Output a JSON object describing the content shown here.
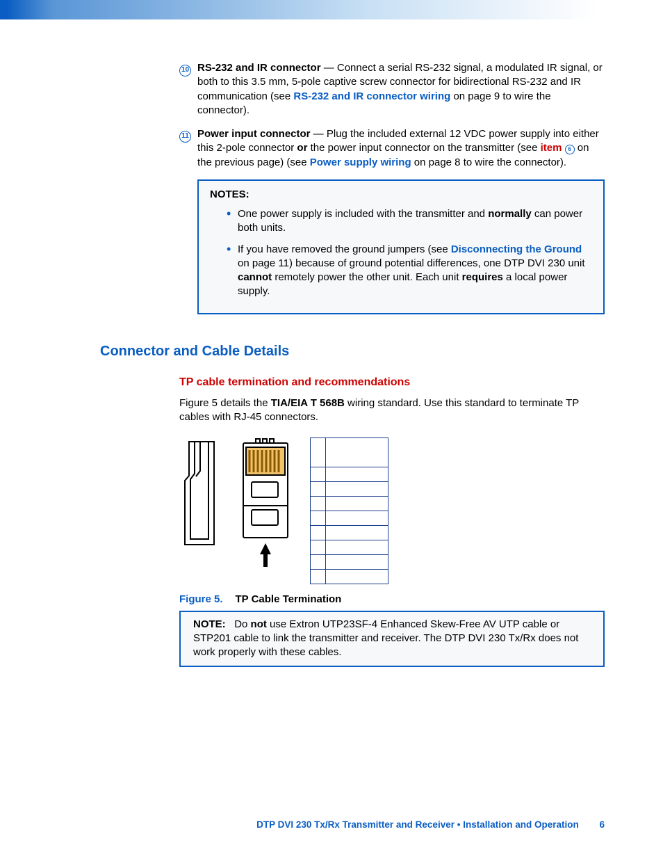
{
  "items": {
    "ten": {
      "num": "10",
      "title": "RS-232 and IR connector",
      "t1": " — Connect a serial RS-232 signal, a modulated IR signal, or both to this 3.5 mm, 5-pole captive screw connector for bidirectional RS-232 and IR communication (see ",
      "link1": "RS-232 and IR connector wiring",
      "t2": " on page 9 to wire the connector)."
    },
    "eleven": {
      "num": "11",
      "title": "Power input connector",
      "t1": " — Plug the included external 12 VDC power supply into either this 2-pole connector ",
      "or": "or",
      "t2": " the power input connector on the transmitter (see ",
      "link_item": "item ",
      "link_item_num": "6",
      "t3": " on the previous page) (see ",
      "link2": "Power supply wiring",
      "t4": " on page 8 to wire the connector)."
    }
  },
  "notes1": {
    "heading": "NOTES:",
    "bullet1": {
      "a": "One power supply is included with the transmitter and ",
      "b": "normally",
      "c": " can power both units."
    },
    "bullet2": {
      "a": "If you have removed the ground jumpers (see ",
      "link": "Disconnecting the Ground",
      "b": " on page 11) because of ground potential differences, one DTP DVI 230 unit ",
      "cannot": "cannot",
      "c": " remotely power the other unit. Each unit ",
      "requires": "requires",
      "d": " a local power supply."
    }
  },
  "section_heading": "Connector and Cable Details",
  "sub_heading": "TP cable termination and recommendations",
  "para": {
    "a": "Figure 5 details the ",
    "std": "TIA/EIA T 568B",
    "b": " wiring standard. Use this standard to terminate TP cables with RJ-45 connectors."
  },
  "figure": {
    "label": "Figure 5.",
    "text": "TP Cable Termination"
  },
  "note2": {
    "heading": "NOTE:",
    "a": "Do ",
    "not": "not",
    "b": " use Extron UTP23SF-4 Enhanced Skew-Free AV UTP cable or STP201 cable to link the transmitter and receiver. The DTP DVI 230 Tx/Rx does not work properly with these cables."
  },
  "footer": {
    "product": "DTP DVI 230 Tx/Rx Transmitter and Receiver • Installation and Operation",
    "page": "6"
  }
}
